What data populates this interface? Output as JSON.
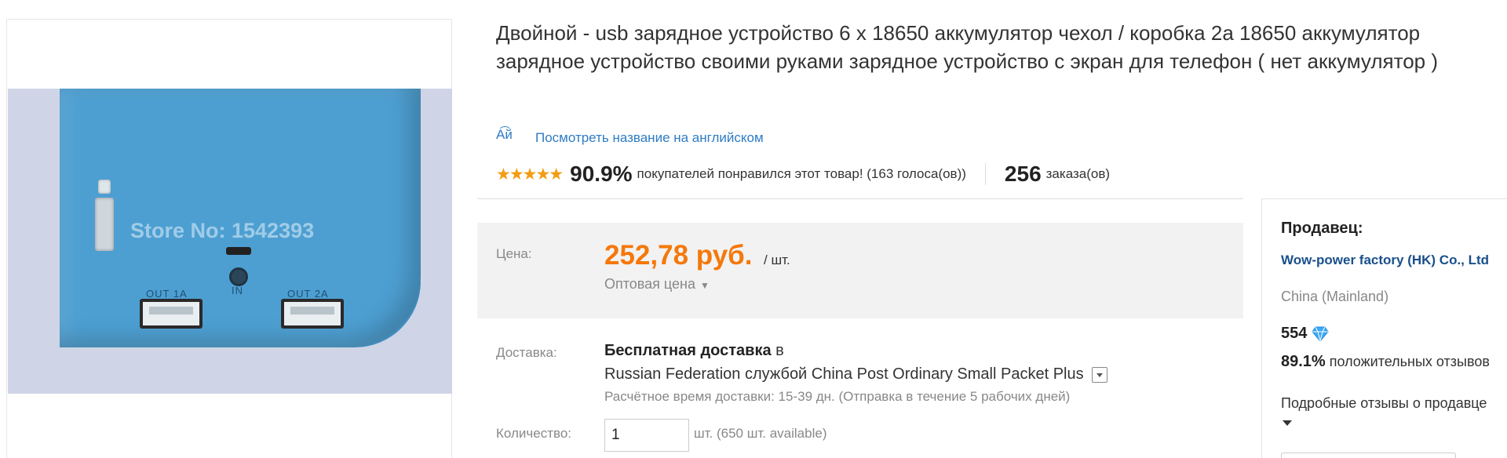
{
  "product": {
    "title": "Двойной - usb зарядное устройство 6 x 18650 аккумулятор чехол / коробка 2а 18650 аккумулятор зарядное устройство своими руками зарядное устройство с экран для телефон ( нет аккумулятор )",
    "image": {
      "watermark": "Store No: 1542393",
      "port_labels": [
        "OUT 1A",
        "IN",
        "OUT 2A"
      ],
      "body_color": "#4d9fd2"
    },
    "translate_icon_text": "A͡й",
    "translate_link": "Посмотреть название на английском"
  },
  "rating": {
    "stars": "★★★★★",
    "percent": "90.9%",
    "text": "покупателей понравился этот товар! (163 голоса(ов))",
    "orders_count": "256",
    "orders_label": "заказа(ов)"
  },
  "price": {
    "label": "Цена:",
    "value": "252,78 руб.",
    "unit": "/ шт.",
    "wholesale": "Оптовая цена",
    "color": "#f5780a"
  },
  "shipping": {
    "label": "Доставка:",
    "free_label": "Бесплатная доставка",
    "in_word": " в",
    "destination": "Russian Federation службой China Post Ordinary Small Packet Plus",
    "estimate": "Расчётное время доставки: 15-39 дн. (Отправка в течение 5 рабочих дней)"
  },
  "quantity": {
    "label": "Количество:",
    "value": "1",
    "available": "шт. (650 шт. available)"
  },
  "seller": {
    "heading": "Продавец:",
    "name": "Wow-power factory (HK) Co., Ltd",
    "country": "China (Mainland)",
    "score": "554",
    "positive_percent": "89.1%",
    "positive_text": "положительных отзывов",
    "feedback_link": "Подробные отзывы о продавце",
    "link_color": "#1a4f8b"
  }
}
